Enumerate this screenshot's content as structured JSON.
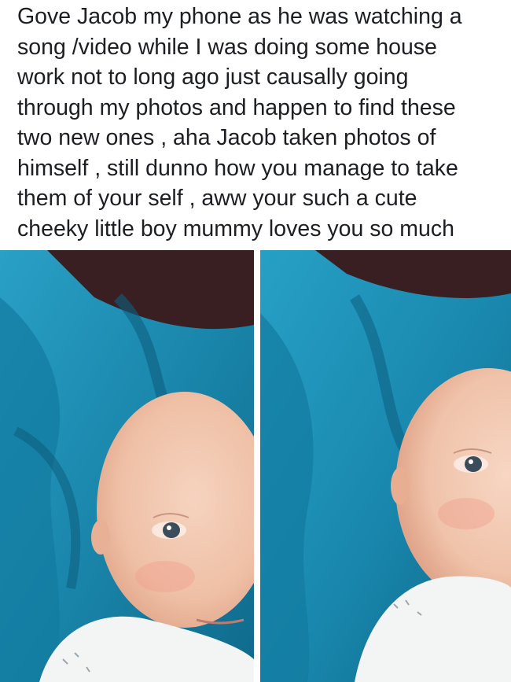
{
  "post": {
    "text_lines": [
      "Gove Jacob my phone as he was watching a",
      "song /video while I was doing some house",
      "work not to long ago just causally going",
      "through my photos and happen to find these",
      "two new ones , aha Jacob taken photos of",
      "himself , still dunno how you manage to take",
      "them of your self , aww your such a cute",
      "cheeky little boy mummy loves you so much"
    ]
  },
  "colors": {
    "blanket": "#1e8fb4",
    "blanket_dark": "#0f6a8c",
    "background_dark": "#3a1f22",
    "skin": "#f0c4ad",
    "onesie": "#f3f5f4"
  }
}
